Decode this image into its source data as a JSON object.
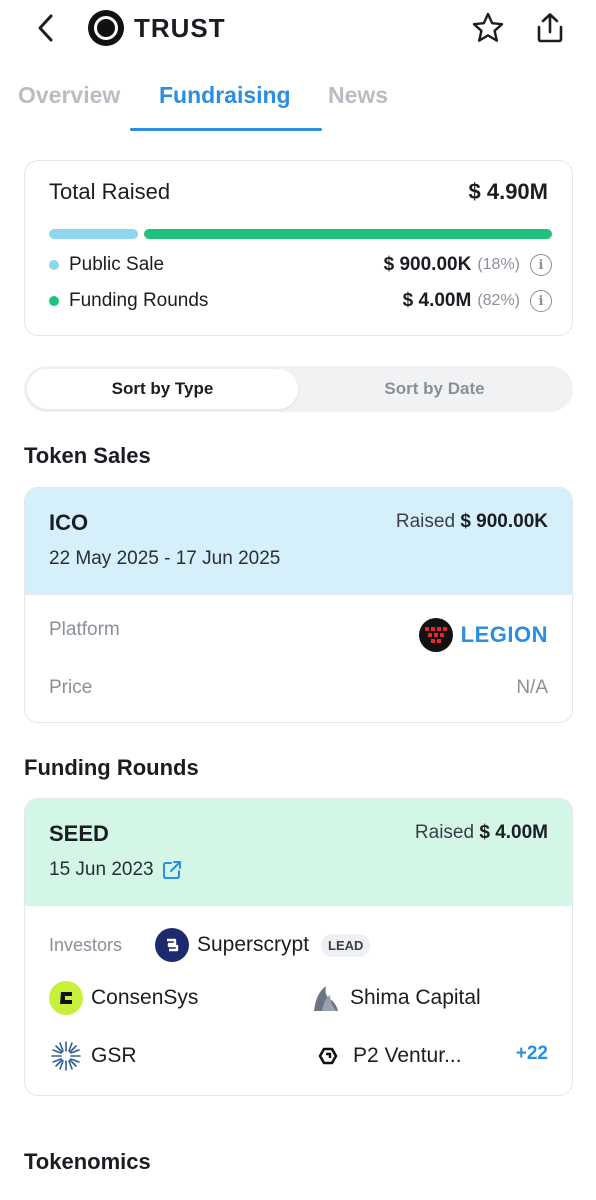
{
  "header": {
    "title": "TRUST"
  },
  "tabs": [
    {
      "label": "Overview",
      "active": false
    },
    {
      "label": "Fundraising",
      "active": true
    },
    {
      "label": "News",
      "active": false
    }
  ],
  "total": {
    "label": "Total Raised",
    "value": "$ 4.90M",
    "breakdown": [
      {
        "label": "Public Sale",
        "value": "$ 900.00K",
        "pct": "(18%)",
        "fraction": 0.18,
        "color": "#8fd7f0"
      },
      {
        "label": "Funding Rounds",
        "value": "$ 4.00M",
        "pct": "(82%)",
        "fraction": 0.82,
        "color": "#1ec27a"
      }
    ]
  },
  "sort": {
    "by_type": "Sort by Type",
    "by_date": "Sort by Date",
    "selected": "by_type"
  },
  "token_sales": {
    "title": "Token Sales",
    "card": {
      "type": "ICO",
      "raised_label": "Raised",
      "raised_value": "$ 900.00K",
      "date": "22 May 2025 - 17 Jun 2025",
      "platform_label": "Platform",
      "platform_name": "LEGION",
      "price_label": "Price",
      "price_value": "N/A"
    }
  },
  "funding_rounds": {
    "title": "Funding Rounds",
    "card": {
      "type": "SEED",
      "raised_label": "Raised",
      "raised_value": "$ 4.00M",
      "date": "15 Jun 2023",
      "investors_label": "Investors",
      "lead": {
        "name": "Superscrypt",
        "badge": "LEAD"
      },
      "investors": [
        {
          "name": "ConsenSys"
        },
        {
          "name": "Shima Capital"
        },
        {
          "name": "GSR"
        },
        {
          "name": "P2 Ventur..."
        }
      ],
      "more": "+22"
    }
  },
  "tokenomics": {
    "title": "Tokenomics"
  },
  "colors": {
    "accent": "#2b8ee0",
    "ico_header": "#d5f0fb",
    "seed_header": "#d3f6e6"
  }
}
